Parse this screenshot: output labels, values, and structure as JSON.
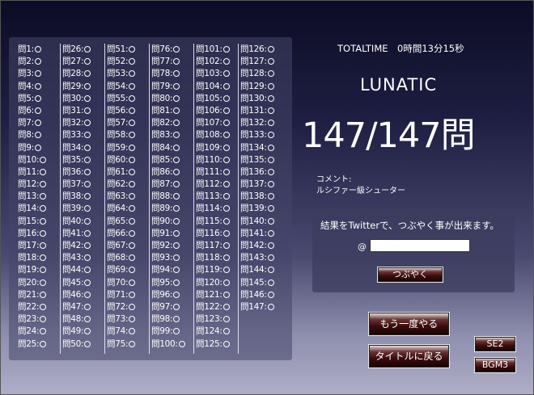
{
  "prefix": "問",
  "mark": "○",
  "total_questions": 147,
  "rows_per_column": 25,
  "total_time": "TOTALTIME　0時間13分15秒",
  "difficulty": "LUNATIC",
  "score": "147/147問",
  "comment_label": "コメント:",
  "comment_text": "ルシファー級シューター",
  "tweet": {
    "message": "結果をTwitterで、つぶやく事が出来ます。",
    "at_sign": "@",
    "input_value": "",
    "button_label": "つぶやく"
  },
  "buttons": {
    "retry": "もう一度やる",
    "title": "タイトルに戻る",
    "se": "SE2",
    "bgm": "BGM3"
  }
}
